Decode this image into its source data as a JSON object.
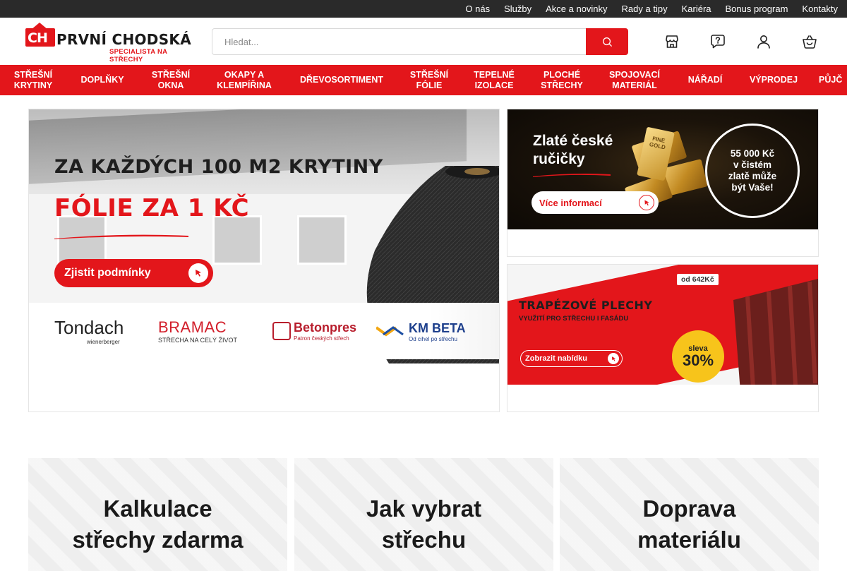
{
  "topbar": {
    "links": [
      "O nás",
      "Služby",
      "Akce a novinky",
      "Rady a tipy",
      "Kariéra",
      "Bonus program",
      "Kontakty"
    ]
  },
  "header": {
    "logo_mark": "CH",
    "logo_name": "PRVNÍ CHODSKÁ",
    "logo_tagline": "SPECIALISTA NA STŘECHY",
    "search_placeholder": "Hledat...",
    "icons": [
      "store-icon",
      "help-icon",
      "user-icon",
      "basket-icon"
    ]
  },
  "categories": [
    "STŘEŠNÍ\nKRYTINY",
    "DOPLŇKY",
    "STŘEŠNÍ\nOKNA",
    "OKAPY A\nKLEMPÍŘINA",
    "DŘEVOSORTIMENT",
    "STŘEŠNÍ\nFÓLIE",
    "TEPELNÉ\nIZOLACE",
    "PLOCHÉ\nSTŘECHY",
    "SPOJOVACÍ\nMATERIÁL",
    "NÁŘADÍ",
    "VÝPRODEJ",
    "PŮJČ"
  ],
  "banner_main": {
    "title_line1": "ZA KAŽDÝCH 100 M2 KRYTINY",
    "title_line2": "FÓLIE ZA 1 KČ",
    "cta": "Zjistit podmínky",
    "brands": {
      "tondach": "Tondach",
      "tondach_sub": "wienerberger",
      "bramac": "BRAMAC",
      "bramac_sub": "STŘECHA NA CELÝ ŽIVOT",
      "betonpres": "Betonpres",
      "betonpres_sub": "Patron českých střech",
      "kmbeta": "KM BETA",
      "kmbeta_sub": "Od cihel po střechu"
    }
  },
  "banner_gold": {
    "title": "Zlaté české\nručičky",
    "bar_text": "FINE\nGOLD",
    "cta": "Více informací",
    "circle": "55 000 Kč\nv čistém\nzlatě může\nbýt Vaše!"
  },
  "banner_trap": {
    "price": "od 642Kč",
    "title": "TRAPÉZOVÉ PLECHY",
    "subtitle": "VYUŽITÍ PRO STŘECHU I FASÁDU",
    "cta": "Zobrazit nabídku",
    "badge_top": "sleva",
    "badge_value": "30%"
  },
  "cards": [
    "Kalkulace\nstřechy zdarma",
    "Jak vybrat\nstřechu",
    "Doprava\nmateriálu"
  ],
  "colors": {
    "brand_red": "#e3161b",
    "topbar_bg": "#2a2a2a",
    "badge_yellow": "#f7c41b"
  }
}
